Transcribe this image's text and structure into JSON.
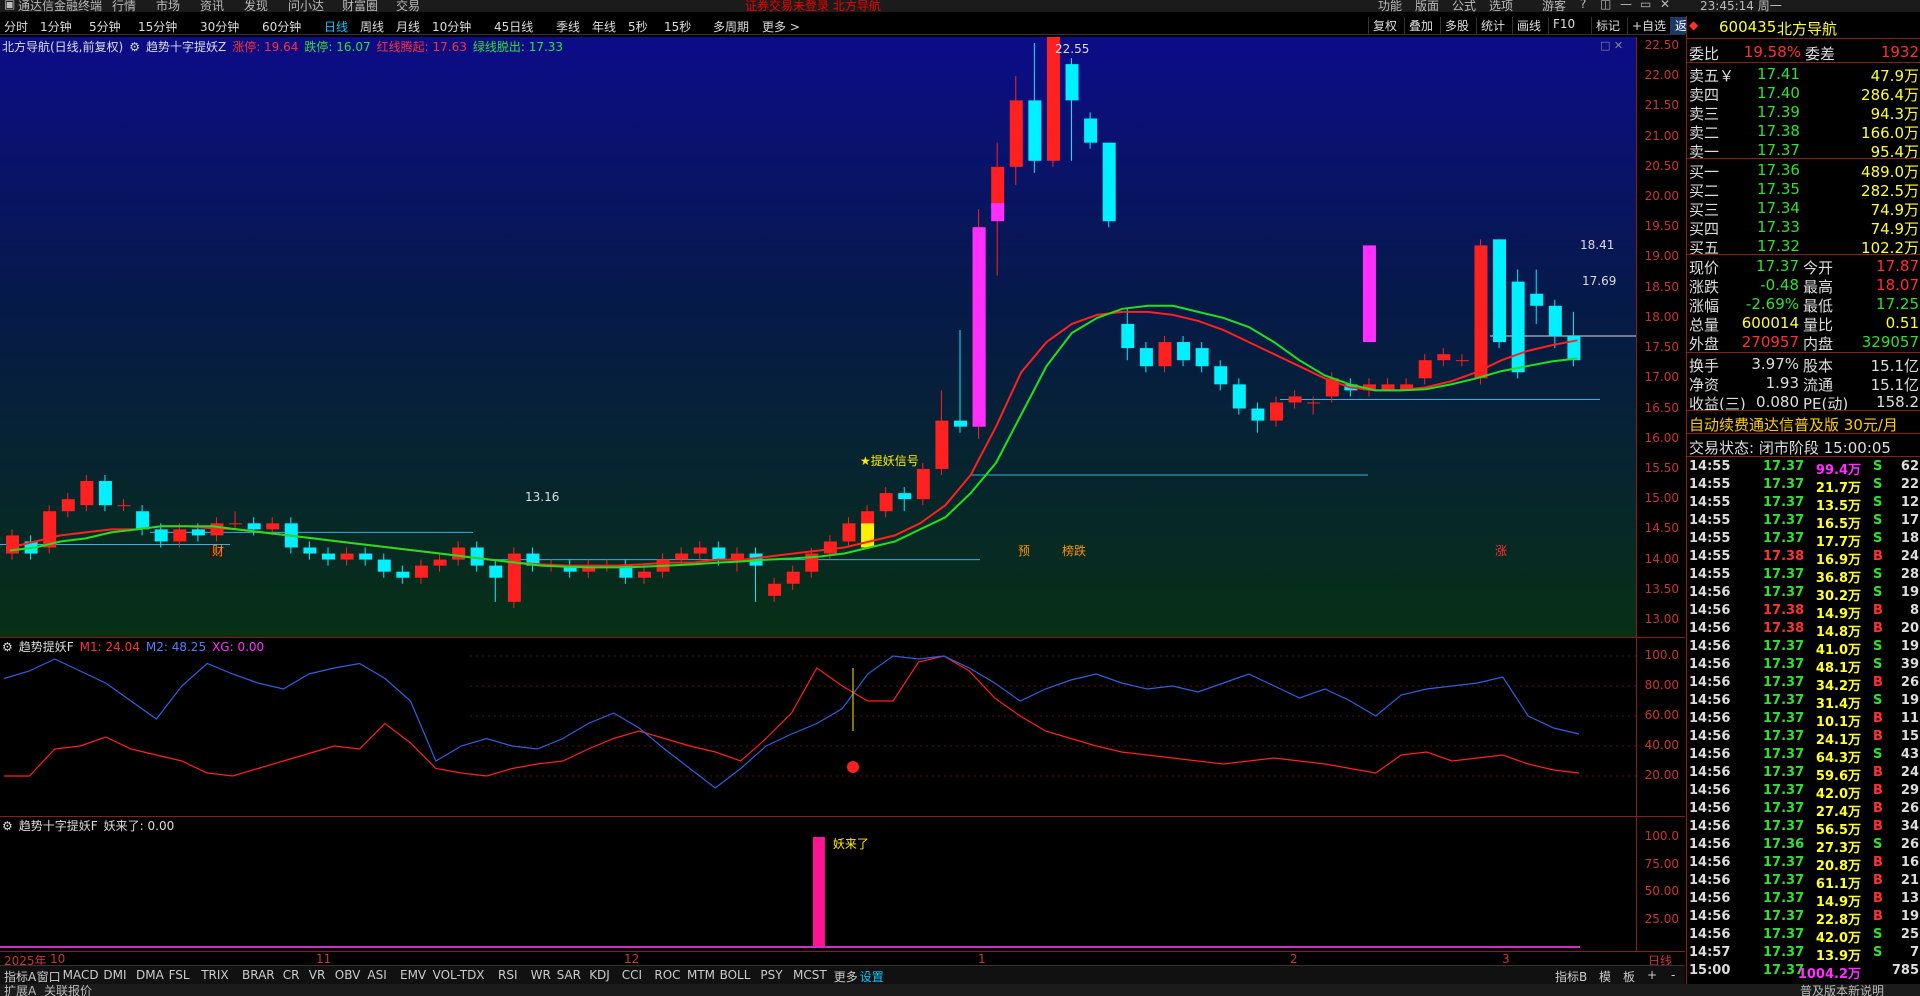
{
  "menubar": {
    "items": [
      "通达信金融终端",
      "行情",
      "市场",
      "资讯",
      "发现",
      "问小达",
      "财富圈",
      "交易"
    ],
    "warning": "证券交易未登录   北方导航",
    "right_items": [
      "功能",
      "版面",
      "公式",
      "选项"
    ],
    "user": "游客",
    "clock": "23:45:14 周一"
  },
  "periods": [
    "分时",
    "1分钟",
    "5分钟",
    "15分钟",
    "30分钟",
    "60分钟",
    "日线",
    "周线",
    "月线",
    "10分钟",
    "45日线",
    "季线",
    "年线",
    "5秒",
    "15秒",
    "多周期",
    "更多 >"
  ],
  "active_period": "日线",
  "right_tools": [
    "复权",
    "叠加",
    "多股",
    "统计",
    "画线",
    "F10",
    "标记",
    "+自选",
    "返回"
  ],
  "main_pane": {
    "stock_label": "北方导航(日线,前复权)",
    "indicator_name": "趋势十字提妖Z",
    "indicators": [
      {
        "label": "涨停: 19.64",
        "color": "#ff3030"
      },
      {
        "label": "跌停: 16.07",
        "color": "#30e030"
      },
      {
        "label": "红线腾起: 17.63",
        "color": "#ff3030"
      },
      {
        "label": "绿线脱出: 17.33",
        "color": "#30e030"
      }
    ],
    "annotations": {
      "high": "22.55",
      "low": "13.16",
      "right_high": "18.41",
      "last": "17.69",
      "signal": "★提妖信号",
      "markers": [
        "财",
        "预",
        "榜跌",
        "涨"
      ]
    }
  },
  "osc_pane": {
    "name": "趋势提妖F",
    "m1": "M1: 24.04",
    "m2": "M2: 48.25",
    "xg": "XG: 0.00",
    "axis_labels": [
      "100.0",
      "80.00",
      "60.00",
      "40.00",
      "20.00"
    ]
  },
  "signal_pane": {
    "name": "趋势十字提妖F",
    "value": "妖来了: 0.00",
    "bar_label": "妖来了",
    "axis_labels": [
      "100.0",
      "75.00",
      "50.00",
      "25.00"
    ]
  },
  "price_axis_labels": [
    "22.50",
    "22.00",
    "21.50",
    "21.00",
    "20.50",
    "20.00",
    "19.50",
    "19.00",
    "18.50",
    "18.00",
    "17.50",
    "17.00",
    "16.50",
    "16.00",
    "15.50",
    "15.00",
    "14.50",
    "14.00",
    "13.50",
    "13.00"
  ],
  "date_axis": {
    "labels": [
      "2025年",
      "10",
      "11",
      "12",
      "1",
      "2",
      "3"
    ],
    "corner": "日线"
  },
  "indicator_tabs": [
    "指标A",
    "窗口",
    "MACD",
    "DMI",
    "DMA",
    "FSL",
    "TRIX",
    "BRAR",
    "CR",
    "VR",
    "OBV",
    "ASI",
    "EMV",
    "VOL-TDX",
    "RSI",
    "WR",
    "SAR",
    "KDJ",
    "CCI",
    "ROC",
    "MTM",
    "BOLL",
    "PSY",
    "MCST",
    "更多",
    "设置"
  ],
  "active_tab": "设置",
  "tabs_right": [
    "指标B",
    "模",
    "板",
    "+",
    "-"
  ],
  "statusbar": {
    "items": [
      "扩展A",
      "关联报价"
    ],
    "right": "普及版本新说明"
  },
  "quote": {
    "code": "600435",
    "name": "北方导航",
    "weibi": {
      "label": "委比",
      "value": "19.58%",
      "label2": "委差",
      "value2": "1932"
    },
    "asks": [
      {
        "label": "卖五￥",
        "price": "17.41",
        "vol": "47.9万"
      },
      {
        "label": "卖四",
        "price": "17.40",
        "vol": "286.4万"
      },
      {
        "label": "卖三",
        "price": "17.39",
        "vol": "94.3万"
      },
      {
        "label": "卖二",
        "price": "17.38",
        "vol": "166.0万"
      },
      {
        "label": "卖一",
        "price": "17.37",
        "vol": "95.4万"
      }
    ],
    "bids": [
      {
        "label": "买一",
        "price": "17.36",
        "vol": "489.0万"
      },
      {
        "label": "买二",
        "price": "17.35",
        "vol": "282.5万"
      },
      {
        "label": "买三",
        "price": "17.34",
        "vol": "74.9万"
      },
      {
        "label": "买四",
        "price": "17.33",
        "vol": "74.9万"
      },
      {
        "label": "买五",
        "price": "17.32",
        "vol": "102.2万"
      }
    ],
    "stats": [
      {
        "l1": "现价",
        "v1": "17.37",
        "c1": "#30e030",
        "l2": "今开",
        "v2": "17.87",
        "c2": "#ff3030"
      },
      {
        "l1": "涨跌",
        "v1": "-0.48",
        "c1": "#30e030",
        "l2": "最高",
        "v2": "18.07",
        "c2": "#ff3030"
      },
      {
        "l1": "涨幅",
        "v1": "-2.69%",
        "c1": "#30e030",
        "l2": "最低",
        "v2": "17.25",
        "c2": "#30e030"
      },
      {
        "l1": "总量",
        "v1": "600014",
        "c1": "#ffff30",
        "l2": "量比",
        "v2": "0.51",
        "c2": "#ffff30"
      },
      {
        "l1": "外盘",
        "v1": "270957",
        "c1": "#ff3030",
        "l2": "内盘",
        "v2": "329057",
        "c2": "#30e030"
      }
    ],
    "stats2": [
      {
        "l1": "换手",
        "v1": "3.97%",
        "l2": "股本",
        "v2": "15.1亿"
      },
      {
        "l1": "净资",
        "v1": "1.93",
        "l2": "流通",
        "v2": "15.1亿"
      },
      {
        "l1": "收益(三)",
        "v1": "0.080",
        "l2": "PE(动)",
        "v2": "158.2"
      }
    ],
    "promo": "自动续费通达信普及版  30元/月",
    "trade_state": "交易状态: 闭市阶段  15:00:05",
    "ticks": [
      {
        "t": "14:55",
        "p": "17.37",
        "v": "99.4万",
        "s": "S",
        "n": "62",
        "vc": "#ff30ff"
      },
      {
        "t": "14:55",
        "p": "17.37",
        "v": "21.7万",
        "s": "S",
        "n": "22",
        "vc": "#ffff30"
      },
      {
        "t": "14:55",
        "p": "17.37",
        "v": "13.5万",
        "s": "S",
        "n": "12",
        "vc": "#ffff30"
      },
      {
        "t": "14:55",
        "p": "17.37",
        "v": "16.5万",
        "s": "S",
        "n": "17",
        "vc": "#ffff30"
      },
      {
        "t": "14:55",
        "p": "17.37",
        "v": "17.7万",
        "s": "S",
        "n": "18",
        "vc": "#ffff30"
      },
      {
        "t": "14:55",
        "p": "17.38",
        "v": "16.9万",
        "s": "B",
        "n": "24",
        "vc": "#ffff30"
      },
      {
        "t": "14:55",
        "p": "17.37",
        "v": "36.8万",
        "s": "S",
        "n": "28",
        "vc": "#ffff30"
      },
      {
        "t": "14:56",
        "p": "17.37",
        "v": "30.2万",
        "s": "S",
        "n": "19",
        "vc": "#ffff30"
      },
      {
        "t": "14:56",
        "p": "17.38",
        "v": "14.9万",
        "s": "B",
        "n": "8",
        "vc": "#ffff30"
      },
      {
        "t": "14:56",
        "p": "17.38",
        "v": "14.8万",
        "s": "B",
        "n": "20",
        "vc": "#ffff30"
      },
      {
        "t": "14:56",
        "p": "17.37",
        "v": "41.0万",
        "s": "S",
        "n": "19",
        "vc": "#ffff30"
      },
      {
        "t": "14:56",
        "p": "17.37",
        "v": "48.1万",
        "s": "S",
        "n": "39",
        "vc": "#ffff30"
      },
      {
        "t": "14:56",
        "p": "17.37",
        "v": "34.2万",
        "s": "B",
        "n": "26",
        "vc": "#ffff30"
      },
      {
        "t": "14:56",
        "p": "17.37",
        "v": "31.4万",
        "s": "S",
        "n": "19",
        "vc": "#ffff30"
      },
      {
        "t": "14:56",
        "p": "17.37",
        "v": "10.1万",
        "s": "B",
        "n": "11",
        "vc": "#ffff30"
      },
      {
        "t": "14:56",
        "p": "17.37",
        "v": "24.1万",
        "s": "B",
        "n": "15",
        "vc": "#ffff30"
      },
      {
        "t": "14:56",
        "p": "17.37",
        "v": "64.3万",
        "s": "S",
        "n": "43",
        "vc": "#ffff30"
      },
      {
        "t": "14:56",
        "p": "17.37",
        "v": "59.6万",
        "s": "B",
        "n": "24",
        "vc": "#ffff30"
      },
      {
        "t": "14:56",
        "p": "17.37",
        "v": "42.0万",
        "s": "B",
        "n": "29",
        "vc": "#ffff30"
      },
      {
        "t": "14:56",
        "p": "17.37",
        "v": "27.4万",
        "s": "B",
        "n": "26",
        "vc": "#ffff30"
      },
      {
        "t": "14:56",
        "p": "17.37",
        "v": "56.5万",
        "s": "B",
        "n": "34",
        "vc": "#ffff30"
      },
      {
        "t": "14:56",
        "p": "17.36",
        "v": "27.3万",
        "s": "S",
        "n": "26",
        "vc": "#ffff30"
      },
      {
        "t": "14:56",
        "p": "17.37",
        "v": "20.8万",
        "s": "B",
        "n": "16",
        "vc": "#ffff30"
      },
      {
        "t": "14:56",
        "p": "17.37",
        "v": "61.1万",
        "s": "B",
        "n": "21",
        "vc": "#ffff30"
      },
      {
        "t": "14:56",
        "p": "17.37",
        "v": "14.9万",
        "s": "B",
        "n": "13",
        "vc": "#ffff30"
      },
      {
        "t": "14:56",
        "p": "17.37",
        "v": "22.8万",
        "s": "B",
        "n": "19",
        "vc": "#ffff30"
      },
      {
        "t": "14:56",
        "p": "17.37",
        "v": "42.0万",
        "s": "S",
        "n": "25",
        "vc": "#ffff30"
      },
      {
        "t": "14:57",
        "p": "17.37",
        "v": "13.9万",
        "s": "S",
        "n": "7",
        "vc": "#ffff30"
      },
      {
        "t": "15:00",
        "p": "17.37",
        "v": "1004.2万",
        "s": "",
        "n": "785",
        "vc": "#ff30ff"
      }
    ]
  },
  "chart_data": [
    {
      "type": "candlestick",
      "title": "北方导航(日线,前复权)",
      "ylim": [
        13.0,
        22.5
      ],
      "series": [
        {
          "name": "红线腾起",
          "color": "#ff2020",
          "values": [
            14.2,
            14.3,
            14.4,
            14.45,
            14.5,
            14.5,
            14.55,
            14.55,
            14.52,
            14.5,
            14.45,
            14.4,
            14.35,
            14.3,
            14.25,
            14.2,
            14.15,
            14.1,
            14.05,
            14.0,
            13.95,
            13.92,
            13.9,
            13.9,
            13.9,
            13.92,
            13.95,
            13.95,
            14.0,
            14.0,
            14.05,
            14.1,
            14.15,
            14.2,
            14.3,
            14.4,
            14.6,
            14.9,
            15.4,
            16.2,
            17.1,
            17.6,
            17.9,
            18.05,
            18.1,
            18.1,
            18.05,
            17.95,
            17.8,
            17.6,
            17.4,
            17.2,
            17.0,
            16.85,
            16.8,
            16.8,
            16.85,
            16.95,
            17.1,
            17.3,
            17.45,
            17.55,
            17.63
          ]
        },
        {
          "name": "绿线脱出",
          "color": "#20e020",
          "values": [
            14.15,
            14.2,
            14.3,
            14.35,
            14.45,
            14.5,
            14.55,
            14.55,
            14.55,
            14.5,
            14.45,
            14.4,
            14.35,
            14.3,
            14.25,
            14.2,
            14.15,
            14.1,
            14.05,
            14.0,
            13.95,
            13.9,
            13.88,
            13.87,
            13.87,
            13.88,
            13.9,
            13.92,
            13.95,
            13.97,
            14.0,
            14.02,
            14.05,
            14.1,
            14.2,
            14.3,
            14.5,
            14.7,
            15.1,
            15.6,
            16.4,
            17.2,
            17.75,
            18.0,
            18.15,
            18.2,
            18.2,
            18.1,
            18.0,
            17.85,
            17.6,
            17.3,
            17.05,
            16.9,
            16.8,
            16.8,
            16.82,
            16.9,
            17.0,
            17.12,
            17.2,
            17.28,
            17.33
          ]
        }
      ]
    },
    {
      "type": "line",
      "title": "趋势提妖F",
      "ylim": [
        0,
        100
      ],
      "series": [
        {
          "name": "M1",
          "color": "#ff2020",
          "values": [
            20,
            20,
            38,
            40,
            46,
            38,
            34,
            30,
            22,
            20,
            25,
            30,
            35,
            40,
            38,
            55,
            42,
            25,
            22,
            20,
            25,
            28,
            30,
            38,
            45,
            50,
            45,
            40,
            36,
            30,
            45,
            62,
            92,
            80,
            70,
            70,
            96,
            100,
            90,
            72,
            60,
            50,
            45,
            40,
            36,
            34,
            32,
            30,
            28,
            30,
            32,
            30,
            28,
            25,
            22,
            34,
            36,
            30,
            32,
            34,
            28,
            24,
            22
          ]
        },
        {
          "name": "M2",
          "color": "#3060e0",
          "values": [
            85,
            90,
            98,
            90,
            82,
            70,
            58,
            80,
            95,
            88,
            82,
            78,
            88,
            92,
            95,
            85,
            70,
            30,
            40,
            45,
            40,
            38,
            45,
            55,
            62,
            52,
            38,
            25,
            12,
            25,
            40,
            48,
            55,
            65,
            88,
            100,
            98,
            100,
            92,
            82,
            70,
            78,
            84,
            88,
            82,
            78,
            80,
            76,
            82,
            88,
            80,
            72,
            78,
            70,
            60,
            74,
            78,
            80,
            82,
            86,
            60,
            52,
            48
          ]
        }
      ]
    },
    {
      "type": "bar",
      "title": "趋势十字提妖F",
      "ylim": [
        0,
        100
      ],
      "series": [
        {
          "name": "妖来了",
          "color": "#ff1493",
          "index": 32,
          "values": [
            100
          ]
        }
      ]
    }
  ],
  "candles": [
    [
      14.1,
      14.4,
      14.5,
      14.0
    ],
    [
      14.3,
      14.1,
      14.4,
      14.0
    ],
    [
      14.2,
      14.8,
      14.9,
      14.1
    ],
    [
      14.8,
      15.0,
      15.1,
      14.7
    ],
    [
      14.9,
      15.3,
      15.4,
      14.8
    ],
    [
      15.3,
      14.9,
      15.4,
      14.8
    ],
    [
      14.9,
      14.9,
      15.0,
      14.8
    ],
    [
      14.8,
      14.5,
      14.9,
      14.4
    ],
    [
      14.5,
      14.3,
      14.6,
      14.2
    ],
    [
      14.3,
      14.5,
      14.6,
      14.2
    ],
    [
      14.5,
      14.4,
      14.6,
      14.3
    ],
    [
      14.4,
      14.6,
      14.7,
      14.3
    ],
    [
      14.6,
      14.6,
      14.8,
      14.5
    ],
    [
      14.6,
      14.5,
      14.7,
      14.4
    ],
    [
      14.5,
      14.6,
      14.7,
      14.4
    ],
    [
      14.6,
      14.2,
      14.7,
      14.1
    ],
    [
      14.2,
      14.1,
      14.3,
      14.0
    ],
    [
      14.1,
      14.0,
      14.2,
      13.9
    ],
    [
      14.0,
      14.1,
      14.2,
      13.9
    ],
    [
      14.1,
      14.0,
      14.2,
      13.9
    ],
    [
      14.0,
      13.8,
      14.1,
      13.7
    ],
    [
      13.8,
      13.7,
      13.9,
      13.6
    ],
    [
      13.7,
      13.9,
      14.0,
      13.6
    ],
    [
      13.9,
      14.0,
      14.1,
      13.8
    ],
    [
      14.0,
      14.2,
      14.3,
      13.9
    ],
    [
      14.2,
      13.9,
      14.3,
      13.8
    ],
    [
      13.9,
      13.7,
      14.0,
      13.3
    ],
    [
      13.3,
      14.1,
      14.2,
      13.2
    ],
    [
      14.1,
      13.9,
      14.2,
      13.8
    ],
    [
      13.9,
      13.9,
      14.0,
      13.8
    ],
    [
      13.9,
      13.8,
      14.0,
      13.7
    ],
    [
      13.8,
      13.9,
      14.0,
      13.7
    ],
    [
      13.9,
      13.9,
      14.0,
      13.8
    ],
    [
      13.9,
      13.7,
      14.0,
      13.6
    ],
    [
      13.7,
      13.8,
      13.9,
      13.6
    ],
    [
      13.8,
      14.0,
      14.1,
      13.7
    ],
    [
      14.0,
      14.1,
      14.2,
      13.9
    ],
    [
      14.1,
      14.2,
      14.3,
      14.0
    ],
    [
      14.2,
      14.0,
      14.3,
      13.9
    ],
    [
      14.0,
      14.1,
      14.2,
      13.8
    ],
    [
      14.1,
      13.9,
      14.2,
      13.3
    ],
    [
      13.4,
      13.6,
      13.7,
      13.3
    ],
    [
      13.6,
      13.8,
      13.9,
      13.5
    ],
    [
      13.8,
      14.1,
      14.2,
      13.7
    ],
    [
      14.1,
      14.3,
      14.4,
      14.0
    ],
    [
      14.3,
      14.6,
      14.7,
      14.2
    ],
    [
      14.6,
      14.8,
      14.9,
      14.5
    ],
    [
      14.8,
      15.1,
      15.2,
      14.7
    ],
    [
      15.1,
      15.0,
      15.2,
      14.8
    ],
    [
      15.0,
      15.5,
      15.6,
      14.9
    ],
    [
      15.5,
      16.3,
      16.8,
      15.4
    ],
    [
      16.3,
      16.2,
      17.8,
      16.1
    ],
    [
      16.2,
      19.5,
      19.8,
      16.0
    ],
    [
      19.8,
      20.5,
      20.9,
      18.7
    ],
    [
      20.5,
      21.6,
      22.0,
      20.2
    ],
    [
      21.6,
      20.6,
      22.55,
      20.4
    ],
    [
      20.6,
      22.8,
      22.9,
      20.5
    ],
    [
      22.2,
      21.6,
      22.3,
      20.6
    ],
    [
      21.3,
      20.9,
      21.4,
      20.8
    ],
    [
      20.9,
      19.6,
      20.1,
      19.5
    ]
  ]
}
